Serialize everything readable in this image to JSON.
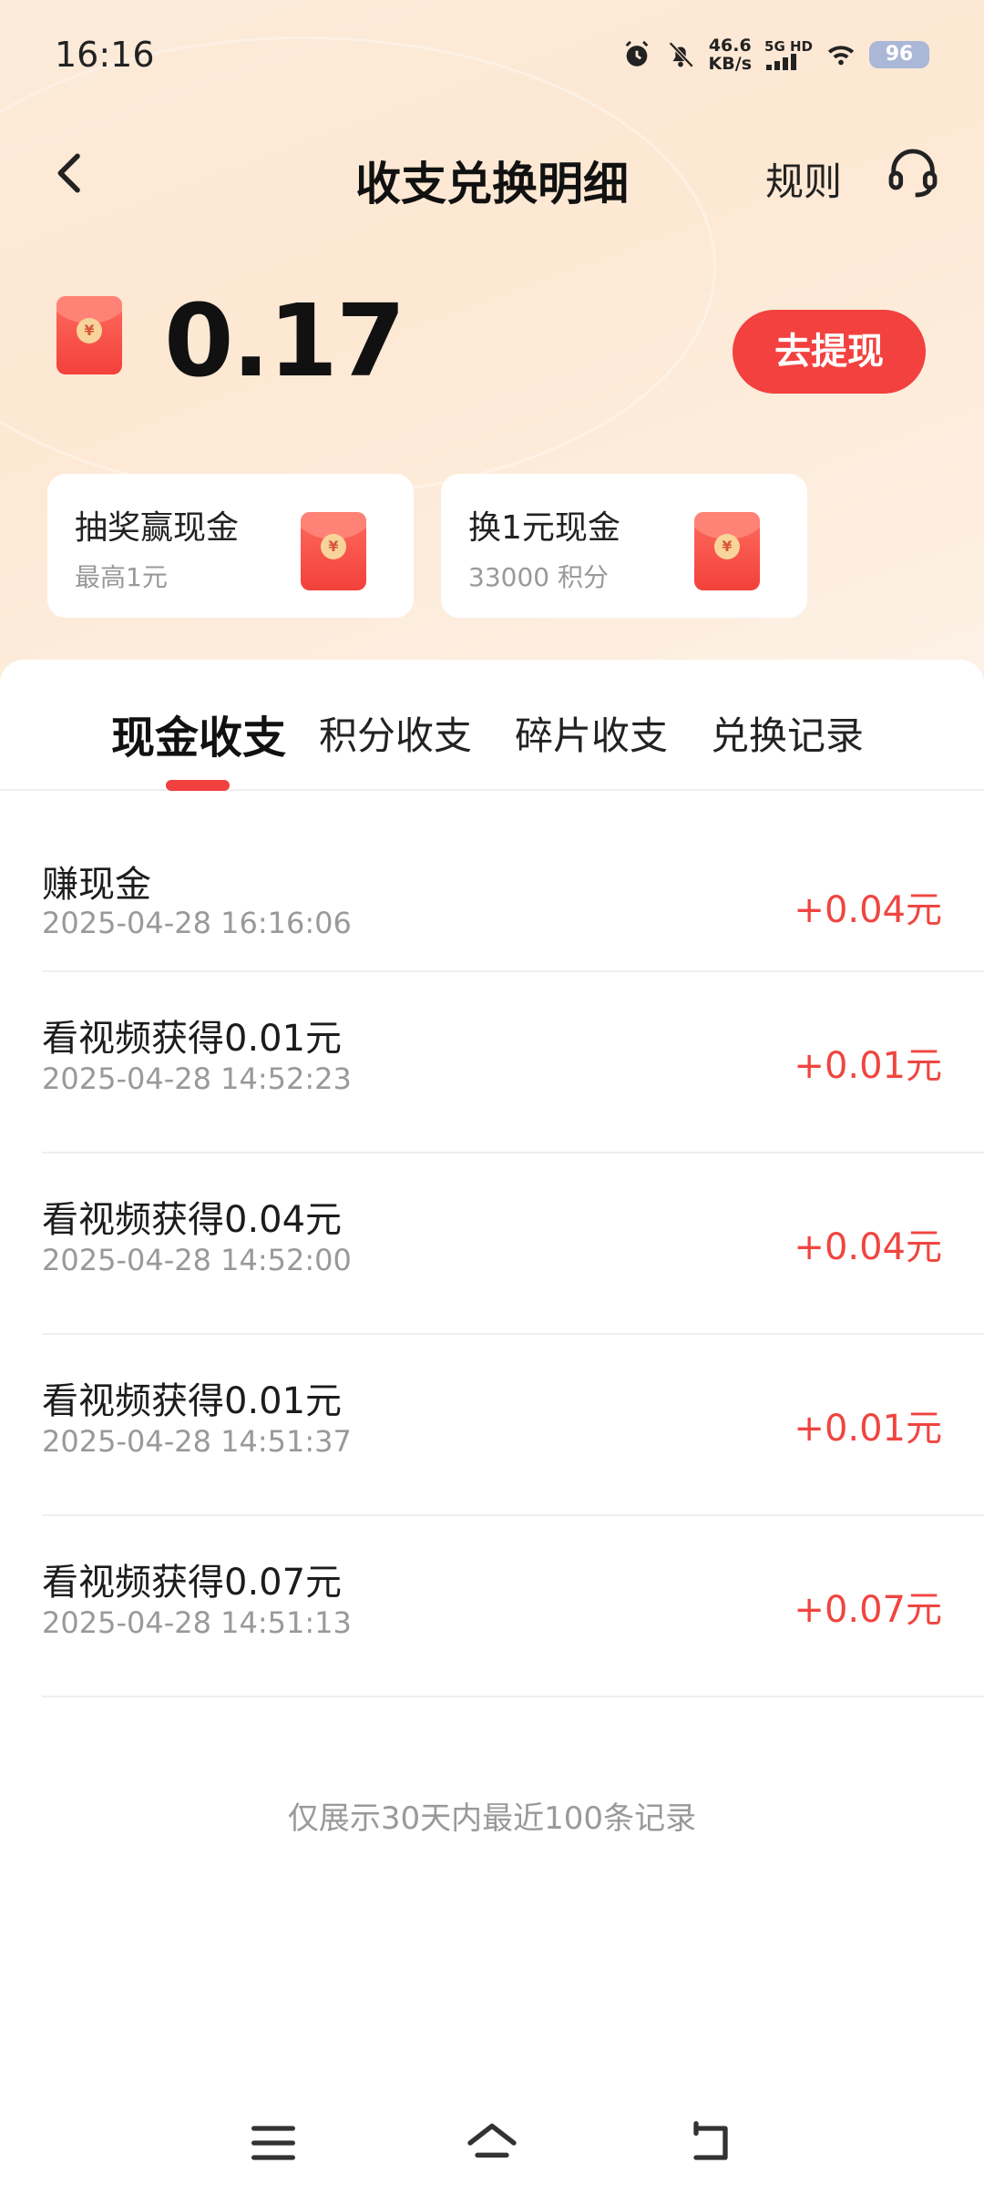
{
  "status_bar": {
    "time": "16:16",
    "net_speed_value": "46.6",
    "net_speed_unit": "KB/s",
    "signal_label": "5G HD",
    "battery": "96"
  },
  "header": {
    "title": "收支兑换明细",
    "rules_label": "规则"
  },
  "balance": {
    "value": "0.17",
    "withdraw_label": "去提现"
  },
  "cards": [
    {
      "title": "抽奖赢现金",
      "subtitle": "最高1元"
    },
    {
      "title": "换1元现金",
      "subtitle": "33000 积分"
    }
  ],
  "tabs": [
    {
      "label": "现金收支",
      "active": true
    },
    {
      "label": "积分收支",
      "active": false
    },
    {
      "label": "碎片收支",
      "active": false
    },
    {
      "label": "兑换记录",
      "active": false
    }
  ],
  "transactions": [
    {
      "title": "赚现金",
      "time": "2025-04-28 16:16:06",
      "amount": "+0.04元"
    },
    {
      "title": "看视频获得0.01元",
      "time": "2025-04-28 14:52:23",
      "amount": "+0.01元"
    },
    {
      "title": "看视频获得0.04元",
      "time": "2025-04-28 14:52:00",
      "amount": "+0.04元"
    },
    {
      "title": "看视频获得0.01元",
      "time": "2025-04-28 14:51:37",
      "amount": "+0.01元"
    },
    {
      "title": "看视频获得0.07元",
      "time": "2025-04-28 14:51:13",
      "amount": "+0.07元"
    }
  ],
  "footer_note": "仅展示30天内最近100条记录",
  "colors": {
    "accent": "#f2413f",
    "amount": "#f04540",
    "header_bg": "#fde8d3"
  }
}
